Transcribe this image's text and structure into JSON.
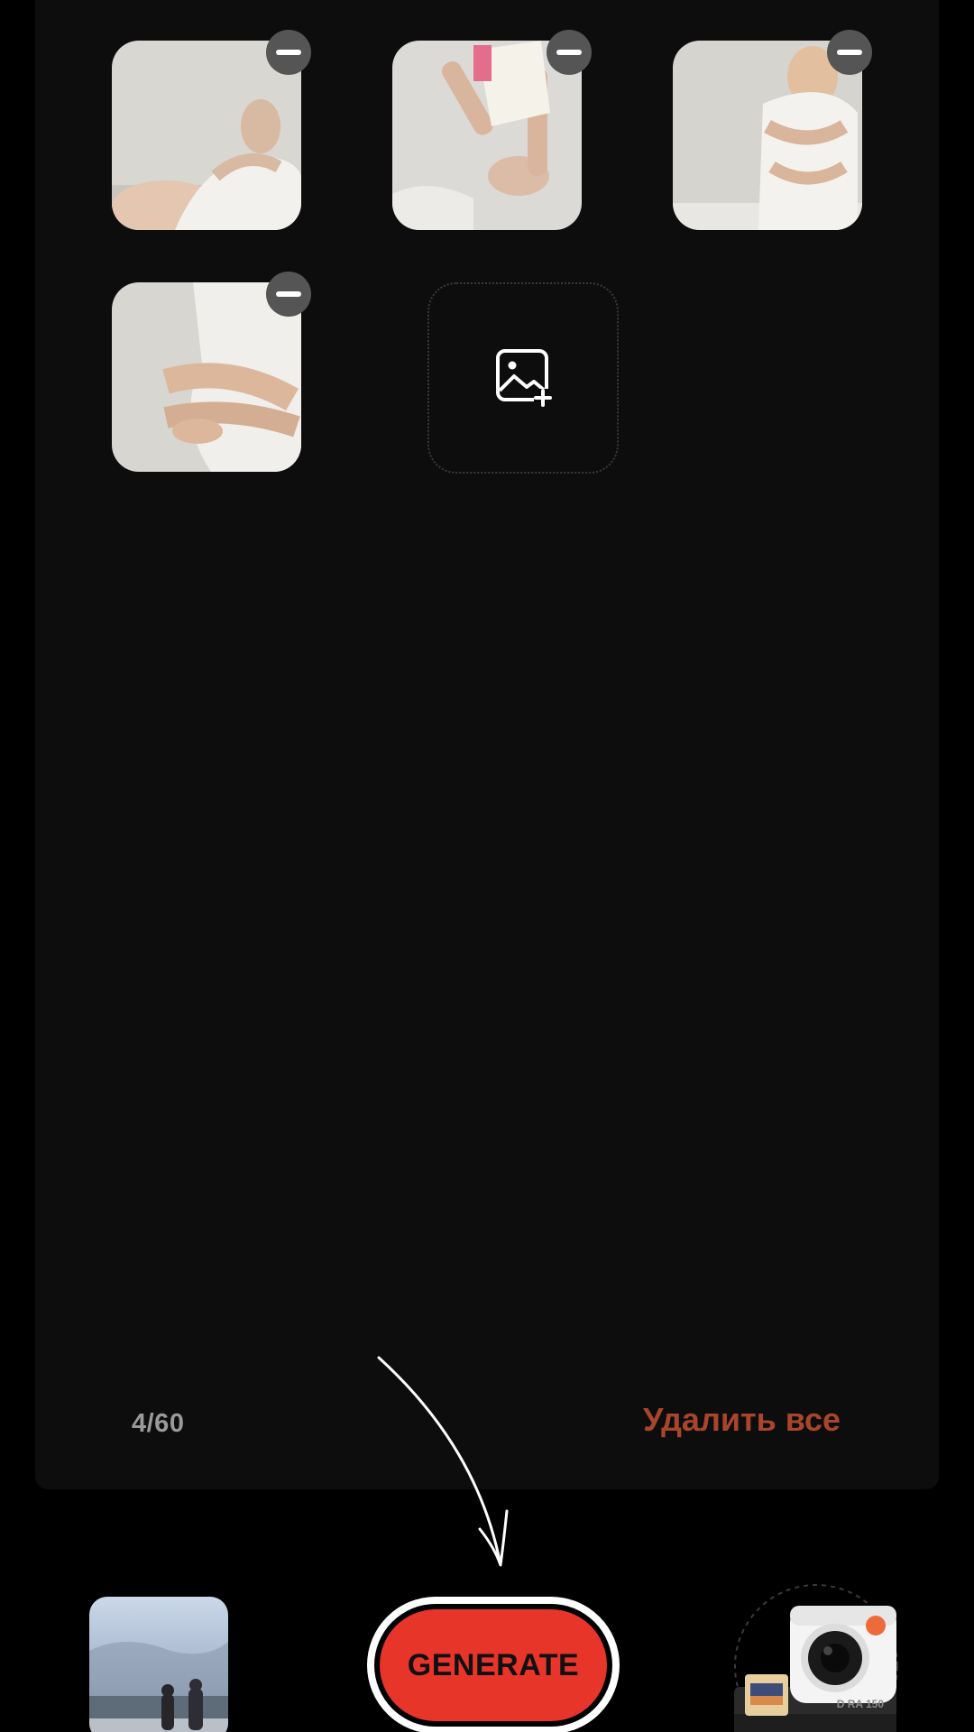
{
  "gallery": {
    "photos": [
      {
        "alt": "photo-1"
      },
      {
        "alt": "photo-2"
      },
      {
        "alt": "photo-3"
      },
      {
        "alt": "photo-4"
      }
    ],
    "add_icon": "image-add-icon",
    "remove_icon": "minus-icon"
  },
  "footer": {
    "counter": "4/60",
    "delete_all": "Удалить все"
  },
  "bottom_bar": {
    "generate_label": "GENERATE",
    "camera_model": "D RA 150"
  },
  "colors": {
    "background": "#000000",
    "panel": "#0d0d0d",
    "accent_red": "#e8352a",
    "delete_text": "#a8452a",
    "counter_text": "#9a9a9a"
  }
}
